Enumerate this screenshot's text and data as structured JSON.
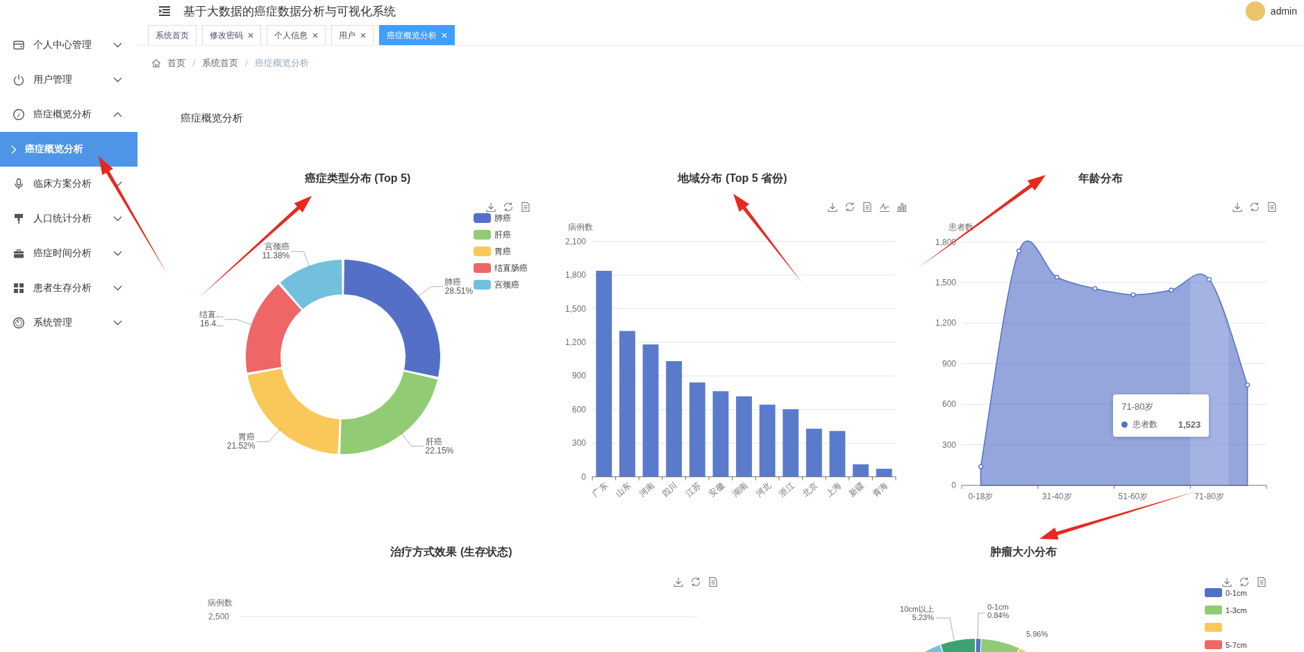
{
  "header": {
    "title": "基于大数据的癌症数据分析与可视化系统",
    "user": "admin"
  },
  "sidebar": {
    "items": [
      {
        "label": "个人中心管理",
        "expanded": false,
        "selected": false
      },
      {
        "label": "用户管理",
        "expanded": false,
        "selected": false
      },
      {
        "label": "癌症概览分析",
        "expanded": true,
        "selected": false,
        "children": [
          {
            "label": "癌症概览分析",
            "selected": true
          }
        ]
      },
      {
        "label": "临床方案分析",
        "expanded": false,
        "selected": false
      },
      {
        "label": "人口统计分析",
        "expanded": false,
        "selected": false
      },
      {
        "label": "癌症时间分析",
        "expanded": false,
        "selected": false
      },
      {
        "label": "患者生存分析",
        "expanded": false,
        "selected": false
      },
      {
        "label": "系统管理",
        "expanded": false,
        "selected": false
      }
    ]
  },
  "tabs": [
    {
      "label": "系统首页",
      "closable": false,
      "selected": false
    },
    {
      "label": "修改密码",
      "closable": true,
      "selected": false
    },
    {
      "label": "个人信息",
      "closable": true,
      "selected": false
    },
    {
      "label": "用户",
      "closable": true,
      "selected": false
    },
    {
      "label": "癌症概览分析",
      "closable": true,
      "selected": true
    }
  ],
  "breadcrumb": [
    {
      "label": "首页",
      "current": false
    },
    {
      "label": "系统首页",
      "current": false
    },
    {
      "label": "癌症概览分析",
      "current": true
    }
  ],
  "page_title": "癌症概览分析",
  "cancer_types": {
    "slices": [
      {
        "name": "肺癌",
        "value": "28.51%",
        "color": "#5470c6"
      },
      {
        "name": "肝癌",
        "value": "22.15%",
        "color": "#91cc75"
      },
      {
        "name": "胃癌",
        "value": "21.52%",
        "color": "#fac858"
      },
      {
        "name": "结直...",
        "value": "16.4...",
        "color": "#ee6666"
      },
      {
        "name": "宫颈癌",
        "value": "11.38%",
        "color": "#73c0de"
      }
    ],
    "chart_data": {
      "type": "donut",
      "title": "癌症类型分布 (Top 5)",
      "categories": [
        "肺癌",
        "肝癌",
        "胃癌",
        "结直肠癌",
        "宫颈癌"
      ],
      "values": [
        28.51,
        22.15,
        21.52,
        16.44,
        11.38
      ],
      "legend": true
    }
  },
  "regions": {
    "chart_data": {
      "type": "bar",
      "title": "地域分布 (Top 5 省份)",
      "ylabel": "病例数",
      "categories": [
        "广东",
        "山东",
        "河南",
        "四川",
        "江苏",
        "安徽",
        "湖南",
        "河北",
        "浙江",
        "北京",
        "上海",
        "新疆",
        "青海"
      ],
      "values": [
        1838,
        1301,
        1181,
        1032,
        842,
        764,
        718,
        644,
        603,
        429,
        409,
        112,
        72
      ],
      "ylim": [
        0,
        2100
      ],
      "grid": true,
      "yticks": [
        0,
        300,
        600,
        900,
        {
          "value": 1200,
          "label": "1,200"
        },
        {
          "value": 1500,
          "label": "1,500"
        },
        {
          "value": 1800,
          "label": "1,800"
        },
        {
          "value": 2100,
          "label": "2,100"
        }
      ]
    }
  },
  "ages": {
    "tooltip": {
      "title": "71-80岁",
      "value": "1,523"
    },
    "chart_data": {
      "type": "area",
      "title": "年龄分布",
      "ylabel": "患者数",
      "categories": [
        "0-18岁",
        null,
        "31-40岁",
        null,
        "51-60岁",
        null,
        "71-80岁",
        null
      ],
      "series": [
        {
          "name": "患者数",
          "color": "#5470c6",
          "values": [
            139,
            1733,
            1539,
            1455,
            1410,
            1444,
            1523,
            742
          ]
        }
      ],
      "ylim": [
        0,
        1800
      ],
      "grid": true,
      "yticks": [
        0,
        300,
        600,
        900,
        {
          "value": 1200,
          "label": "1,200"
        },
        {
          "value": 1500,
          "label": "1,500"
        },
        {
          "value": 1800,
          "label": "1,800"
        }
      ]
    }
  },
  "treatment": {
    "title": "治疗方式效果 (生存状态)",
    "ylabel": "病例数",
    "top_tick": "2,500"
  },
  "tumor_size": {
    "title": "肿瘤大小分布",
    "legend": [
      {
        "label": "0-1cm",
        "color": "#5470c6"
      },
      {
        "label": "1-3cm",
        "color": "#91cc75"
      },
      {
        "color": "#fac858"
      },
      {
        "label": "5-7cm",
        "color": "#ee6666"
      }
    ],
    "slice_labels": [
      {
        "name": "10cm以上",
        "value": "5.23%"
      },
      {
        "name": "0-1cm",
        "value": "0.84%"
      },
      {
        "value": "5.96%"
      }
    ]
  }
}
